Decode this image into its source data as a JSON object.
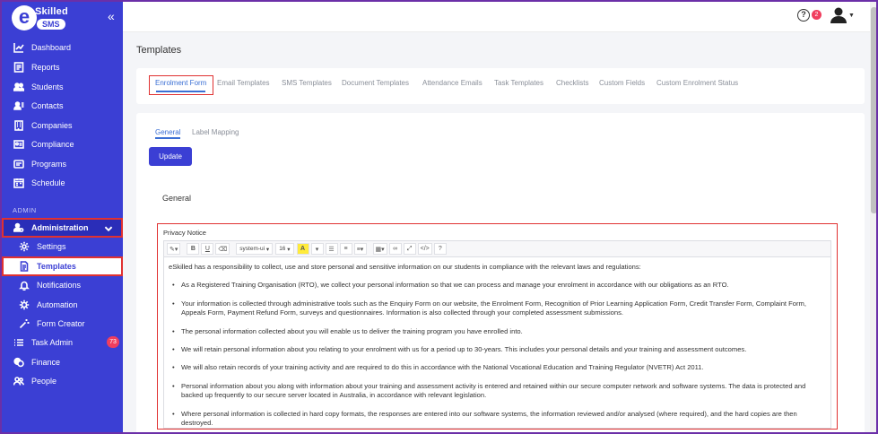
{
  "logo": {
    "mark": "e",
    "line1": "Skilled",
    "line2": "SMS"
  },
  "sidebar": {
    "collapse_icon": "double-chevron-left",
    "section_label": "ADMIN",
    "items": [
      {
        "label": "Dashboard",
        "icon": "chart-line-icon"
      },
      {
        "label": "Reports",
        "icon": "report-icon"
      },
      {
        "label": "Students",
        "icon": "users-icon"
      },
      {
        "label": "Contacts",
        "icon": "contact-icon"
      },
      {
        "label": "Companies",
        "icon": "building-icon"
      },
      {
        "label": "Compliance",
        "icon": "id-card-icon"
      },
      {
        "label": "Programs",
        "icon": "program-icon"
      },
      {
        "label": "Schedule",
        "icon": "calendar-icon"
      }
    ],
    "admin_items": [
      {
        "label": "Administration",
        "icon": "user-cog-icon"
      },
      {
        "label": "Settings",
        "icon": "gear-icon"
      },
      {
        "label": "Templates",
        "icon": "document-icon"
      },
      {
        "label": "Notifications",
        "icon": "bell-icon"
      },
      {
        "label": "Automation",
        "icon": "cog-icon"
      },
      {
        "label": "Form Creator",
        "icon": "wand-icon"
      },
      {
        "label": "Task Admin",
        "icon": "list-icon",
        "badge": "73"
      },
      {
        "label": "Finance",
        "icon": "coins-icon"
      },
      {
        "label": "People",
        "icon": "people-icon"
      }
    ]
  },
  "topbar": {
    "help_badge": "2"
  },
  "page": {
    "title": "Templates"
  },
  "tabs": [
    "Enrolment Form",
    "Email Templates",
    "SMS Templates",
    "Document Templates",
    "Attendance Emails",
    "Task Templates",
    "Checklists",
    "Custom Fields",
    "Custom Enrolment Status"
  ],
  "subtabs": [
    "General",
    "Label Mapping"
  ],
  "update_label": "Update",
  "section_title": "General",
  "privacy": {
    "label": "Privacy Notice",
    "toolbar": {
      "font_family": "system-ui",
      "font_size": "16",
      "bold": "B",
      "underline": "U",
      "help": "?"
    },
    "intro": "eSkilled has a responsibility to collect, use and store personal and sensitive information on our students in compliance with the relevant laws and regulations:",
    "bullets": [
      "As a Registered Training Organisation (RTO), we collect your personal information so that we can process and manage your enrolment in accordance with our obligations as an RTO.",
      "Your information is collected through administrative tools such as the Enquiry Form on our website, the Enrolment Form, Recognition of Prior Learning Application Form, Credit Transfer Form, Complaint Form, Appeals Form, Payment Refund Form, surveys and questionnaires. Information is also collected through your completed assessment submissions.",
      "The personal information collected about you will enable us to deliver the training program you have enrolled into.",
      "We will retain personal information about you relating to your enrolment with us for a period up to 30-years. This includes your personal details and your training and assessment outcomes.",
      "We will also retain records of your training activity and are required to do this in accordance with the National Vocational Education and Training Regulator (NVETR) Act 2011.",
      "Personal information about you along with information about your training and assessment activity is entered and retained within our secure computer network and software systems. The data is protected and backed up frequently to our secure server located in Australia, in accordance with relevant legislation.",
      "Where personal information is collected in hard copy formats, the responses are entered into our software systems, the information reviewed and/or analysed (where required), and the hard copies are then destroyed."
    ]
  },
  "colors": {
    "sidebar": "#3b3fd4",
    "accent": "#3b6fd4",
    "highlight": "#e03131",
    "badge": "#f03e5e"
  }
}
